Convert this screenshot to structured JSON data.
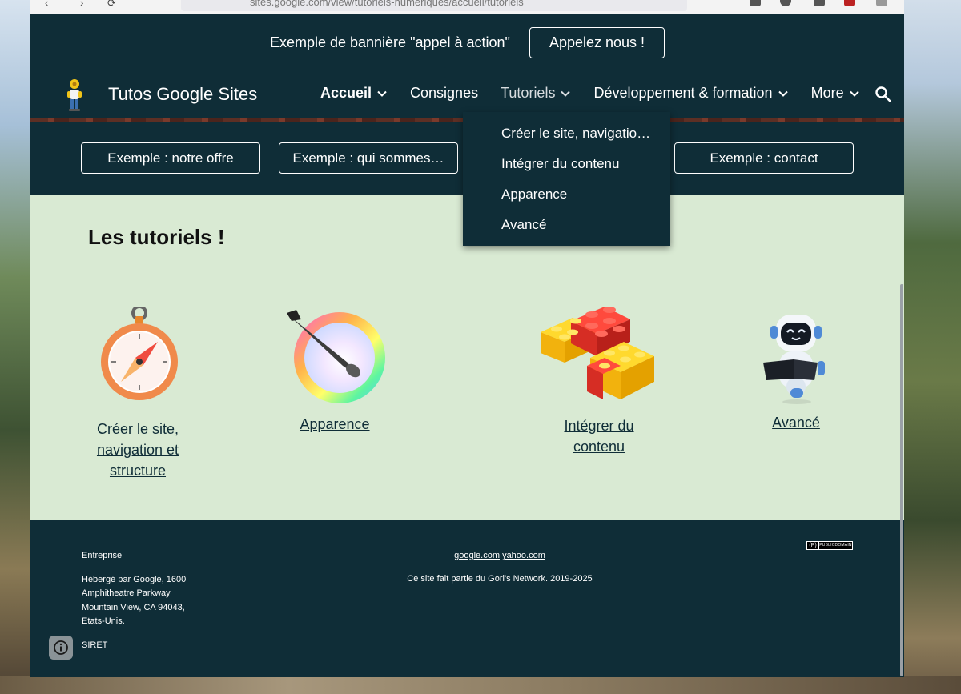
{
  "browser": {
    "url": "sites.google.com/view/tutoriels-numeriques/accueil/tutoriels",
    "back_glyph": "‹",
    "forward_glyph": "›",
    "reload_glyph": "⟳"
  },
  "banner": {
    "text": "Exemple de bannière \"appel à action\"",
    "button_label": "Appelez nous !"
  },
  "header": {
    "site_title": "Tutos Google Sites",
    "nav": [
      {
        "label": "Accueil",
        "has_menu": true,
        "active": true
      },
      {
        "label": "Consignes",
        "has_menu": false
      },
      {
        "label": "Tutoriels",
        "has_menu": true,
        "open": true
      },
      {
        "label": "Développement & formation",
        "has_menu": true
      },
      {
        "label": "More",
        "has_menu": true
      }
    ],
    "search_icon": "search-icon"
  },
  "subnav": {
    "buttons": [
      "Exemple : notre offre",
      "Exemple : qui sommes…",
      "Exemple : contact"
    ]
  },
  "dropdown": {
    "items": [
      "Créer le site, navigatio…",
      "Intégrer du contenu",
      "Apparence",
      "Avancé"
    ]
  },
  "main": {
    "title": "Les tutoriels !",
    "cards": [
      {
        "link": "Créer le site, navigation et structure",
        "icon": "compass-icon"
      },
      {
        "link": "Apparence",
        "icon": "paintbrush-palette-icon"
      },
      {
        "link": "Intégrer du contenu",
        "icon": "lego-bricks-icon"
      },
      {
        "link": "Avancé",
        "icon": "robot-icon"
      }
    ]
  },
  "footer": {
    "company": "Entreprise",
    "address_lines": [
      "Hébergé par Google, 1600",
      "Amphitheatre Parkway",
      "Mountain View, CA 94043,",
      "Etats-Unis."
    ],
    "siret": "SIRET",
    "links": [
      "google.com",
      "yahoo.com"
    ],
    "network": "Ce site fait partie du Gori's Network. 2019-2025",
    "license_badge": {
      "left": "(P)",
      "right": "PUBLICDOMAIN"
    }
  },
  "colors": {
    "site_dark": "#0f2d37",
    "content_bg": "#d9ead3",
    "link": "#0f2d37"
  }
}
